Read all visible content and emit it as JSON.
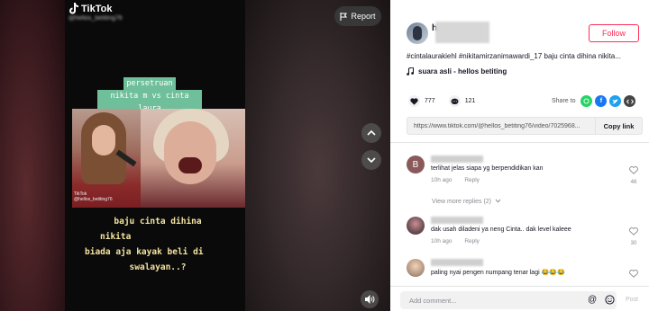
{
  "video": {
    "brand": "TikTok",
    "handle_sub": "@hellos_betiting76",
    "report_label": "Report",
    "caption_top": [
      "persetruan",
      "nikita m vs cinta laura"
    ],
    "caption_bottom": [
      "baju cinta dihina",
      "nikita",
      "biada aja kayak beli di",
      "swalayan..?"
    ],
    "watermark_line1": "TikTok",
    "watermark_line2": "@hellos_betiting76"
  },
  "author": {
    "username": "h",
    "follow_label": "Follow"
  },
  "post": {
    "description": "#cintalaurakiehl #nikitamirzanimawardi_17 baju cinta dihina nikita...",
    "music": "suara asli - hellos betiting",
    "likes": "777",
    "comments": "121",
    "share_label": "Share to",
    "link": "https://www.tiktok.com/@hellos_betiting76/video/7025968...",
    "copy_label": "Copy link"
  },
  "comments": [
    {
      "initial": "B",
      "text": "terlihat jelas siapa yg berpendidikan kan",
      "time": "10h ago",
      "reply": "Reply",
      "likes": "46"
    },
    {
      "initial": "",
      "text": "dak usah diladeni ya neng Cinta.. dak level kaleee",
      "time": "10h ago",
      "reply": "Reply",
      "likes": "30"
    },
    {
      "initial": "",
      "text": "paling nyai pengen numpang tenar lagi 😂😂😂",
      "time": "",
      "reply": "",
      "likes": ""
    }
  ],
  "view_more": "View more replies (2)",
  "comment_bar": {
    "placeholder": "Add comment...",
    "post_label": "Post"
  },
  "colors": {
    "accent": "#fe2c55",
    "caption_bg": "#6fbf9a",
    "caption_text": "#f3e3a0",
    "whatsapp": "#25d366",
    "facebook": "#1877f2",
    "twitter": "#1da1f2",
    "embed": "#444444"
  },
  "icons": {
    "share_targets": [
      "whatsapp-icon",
      "facebook-icon",
      "twitter-icon",
      "embed-icon"
    ]
  }
}
